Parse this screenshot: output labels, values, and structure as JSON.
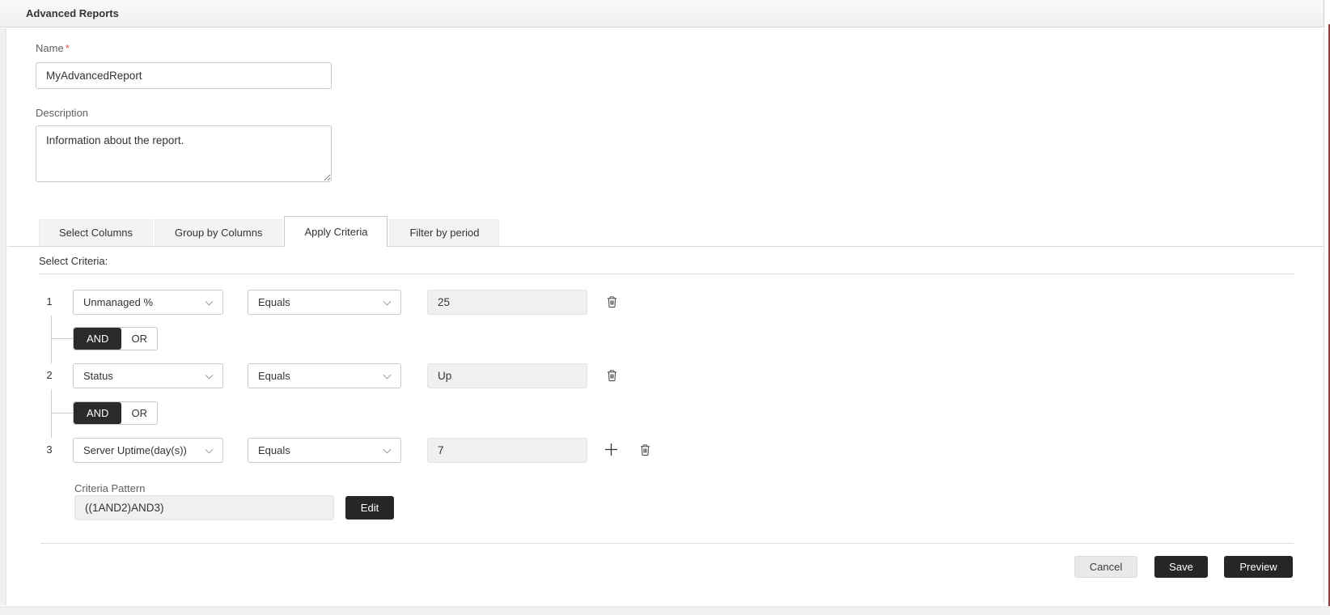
{
  "window": {
    "title": "Advanced Reports"
  },
  "form": {
    "name": {
      "label": "Name",
      "required_mark": "*",
      "value": "MyAdvancedReport"
    },
    "description": {
      "label": "Description",
      "value": "Information about the report."
    }
  },
  "tabs": [
    {
      "label": "Select Columns"
    },
    {
      "label": "Group by Columns"
    },
    {
      "label": "Apply Criteria"
    },
    {
      "label": "Filter by period"
    }
  ],
  "active_tab": "Apply Criteria",
  "criteria": {
    "section_label": "Select Criteria:",
    "rows": [
      {
        "index": "1",
        "field": "Unmanaged %",
        "condition": "Equals",
        "value": "25"
      },
      {
        "index": "2",
        "field": "Status",
        "condition": "Equals",
        "value": "Up"
      },
      {
        "index": "3",
        "field": "Server Uptime(day(s))",
        "condition": "Equals",
        "value": "7"
      }
    ],
    "operators": [
      {
        "options": [
          "AND",
          "OR"
        ],
        "selected": "AND"
      },
      {
        "options": [
          "AND",
          "OR"
        ],
        "selected": "AND"
      }
    ],
    "pattern": {
      "label": "Criteria Pattern",
      "value": "((1AND2)AND3)",
      "edit_label": "Edit"
    }
  },
  "footer": {
    "cancel_label": "Cancel",
    "save_label": "Save",
    "preview_label": "Preview"
  },
  "colors": {
    "primary_button": "#262626",
    "toggle_active": "#2b2b2b",
    "input_fill": "#f0f0f0",
    "required": "#e05252",
    "edge_accent": "#8f4040"
  }
}
